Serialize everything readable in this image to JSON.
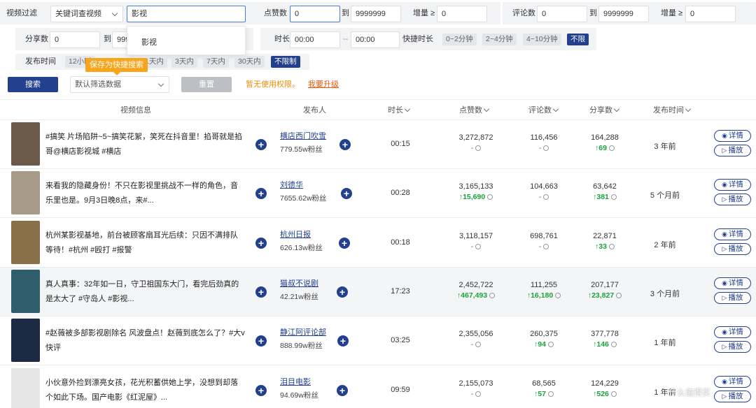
{
  "filter": {
    "video_filter_label": "视频过滤",
    "keyword_mode": "关键词查视频",
    "keyword_value": "影视",
    "suggestion": "影视",
    "likes_label": "点赞数",
    "likes_from": "0",
    "to_label": "到",
    "likes_to": "9999999",
    "increase_label": "增量 ≥",
    "likes_increase": "0",
    "comments_label": "评论数",
    "comments_from": "0",
    "comments_to": "9999999",
    "comments_increase": "0",
    "shares_label": "分享数",
    "shares_from": "0",
    "shares_to": "999",
    "duration_label": "时长",
    "duration_from": "00:00",
    "duration_sep": "--",
    "duration_to": "00:00",
    "quick_duration_label": "快捷时长",
    "quick_durations": [
      "0~2分钟",
      "2~4分钟",
      "4~10分钟",
      "不限"
    ],
    "publish_label": "发布时间",
    "publish_options": [
      "12小时",
      "1天内",
      "3天内",
      "7天内",
      "30天内",
      "不限制"
    ],
    "tooltip": "保存为快捷搜索",
    "search_button": "搜索",
    "preset_select": "默认筛选数据",
    "reset_button": "重置",
    "no_permission": "暂无使用权限。",
    "upgrade": "我要升级"
  },
  "table": {
    "headers": {
      "info": "视频信息",
      "publisher": "发布人",
      "duration": "时长",
      "likes": "点赞数",
      "comments": "评论数",
      "shares": "分享数",
      "publish_time": "发布时间"
    },
    "detail_label": "详情",
    "play_label": "播放",
    "rows": [
      {
        "title": "#搞笑 片场陷阱~5~搞笑花絮，笑死在抖音里！掐哥就是掐哥@横店影视城 #横店",
        "author": "横店西门吹雪",
        "fans": "779.55w粉丝",
        "duration": "00:15",
        "likes": "3,272,872",
        "likes_inc": "-",
        "comments": "116,456",
        "comments_inc": "-",
        "shares": "164,288",
        "shares_inc": "↑69",
        "time": "3 年前",
        "thumb_color": "#6b5a4a"
      },
      {
        "title": "来看我的隐藏身份！不只在影视里挑战不一样的角色，音乐里也是。9月3日晚8点，来#...",
        "author": "刘德华",
        "fans": "7655.62w粉丝",
        "duration": "00:28",
        "likes": "3,165,133",
        "likes_inc": "↑15,690",
        "comments": "104,663",
        "comments_inc": "-",
        "shares": "63,642",
        "shares_inc": "↑381",
        "time": "5 个月前",
        "thumb_color": "#a89a88"
      },
      {
        "title": "杭州某影视基地，前台被顾客扇耳光后续：只因不满排队等待！#杭州 #殴打 #报警",
        "author": "杭州日报",
        "fans": "626.13w粉丝",
        "duration": "00:18",
        "likes": "3,118,157",
        "likes_inc": "-",
        "comments": "698,761",
        "comments_inc": "-",
        "shares": "22,871",
        "shares_inc": "↑33",
        "time": "2 年前",
        "thumb_color": "#8a7048"
      },
      {
        "title": "真人真事：32年如一日，守卫祖国东大门，看完后劲真的是太大了 #守岛人 #影视...",
        "author": "猫叔不说剧",
        "fans": "42.21w粉丝",
        "duration": "17:23",
        "likes": "2,452,722",
        "likes_inc": "↑467,493",
        "comments": "111,255",
        "comments_inc": "↑16,180",
        "shares": "207,177",
        "shares_inc": "↑23,827",
        "time": "3 个月前",
        "thumb_color": "#2f5d6a"
      },
      {
        "title": "#赵薇被多部影视剧除名 风波盘点！赵薇到底怎么了？#大v快评",
        "author": "静江阿评论部",
        "fans": "888.99w粉丝",
        "duration": "03:25",
        "likes": "2,355,056",
        "likes_inc": "-",
        "comments": "260,375",
        "comments_inc": "↑94",
        "shares": "377,778",
        "shares_inc": "↑146",
        "time": "1 年前",
        "thumb_color": "#1d2a44"
      },
      {
        "title": "小伙意外捡到漂亮女孩，花光积蓄供她上学，没想到却落个如此下场。国产电影《红泥屋》...",
        "author": "泪目电影",
        "fans": "94.69w粉丝",
        "duration": "09:59",
        "likes": "2,155,073",
        "likes_inc": "-",
        "comments": "68,565",
        "comments_inc": "↑57",
        "shares": "124,229",
        "shares_inc": "↑526",
        "time": "1 年前",
        "thumb_color": "#e6e6e6"
      }
    ]
  },
  "watermark": "什么值得买",
  "colors": {
    "primary": "#23408e",
    "accent": "#f7a51c",
    "increase": "#1aa33a"
  }
}
